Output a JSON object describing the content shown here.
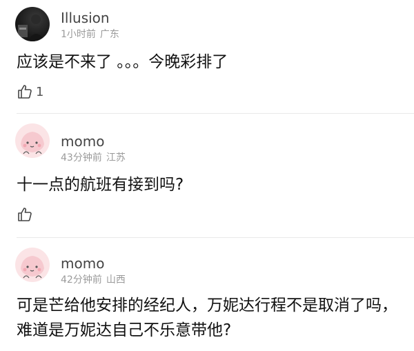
{
  "comments": [
    {
      "username": "Illusion",
      "time": "1小时前",
      "location": "广东",
      "text": "应该是不来了 。。。今晚彩排了",
      "likes": "1",
      "avatar": "dark-photo-avatar"
    },
    {
      "username": "momo",
      "time": "43分钟前",
      "location": "江苏",
      "text": "十一点的航班有接到吗?",
      "likes": "",
      "avatar": "pink-cartoon-avatar"
    },
    {
      "username": "momo",
      "time": "42分钟前",
      "location": "山西",
      "text_lines": [
        "可是芒给他安排的经纪人，万妮达行程不是取消了吗，",
        "难道是万妮达自己不乐意带他?"
      ],
      "avatar": "pink-cartoon-avatar"
    }
  ],
  "icons": {
    "like": "thumbs-up-icon"
  },
  "colors": {
    "username": "#444444",
    "meta": "#9a9a9a",
    "text": "#111111",
    "avatar_pink": "#fbe4e6"
  }
}
